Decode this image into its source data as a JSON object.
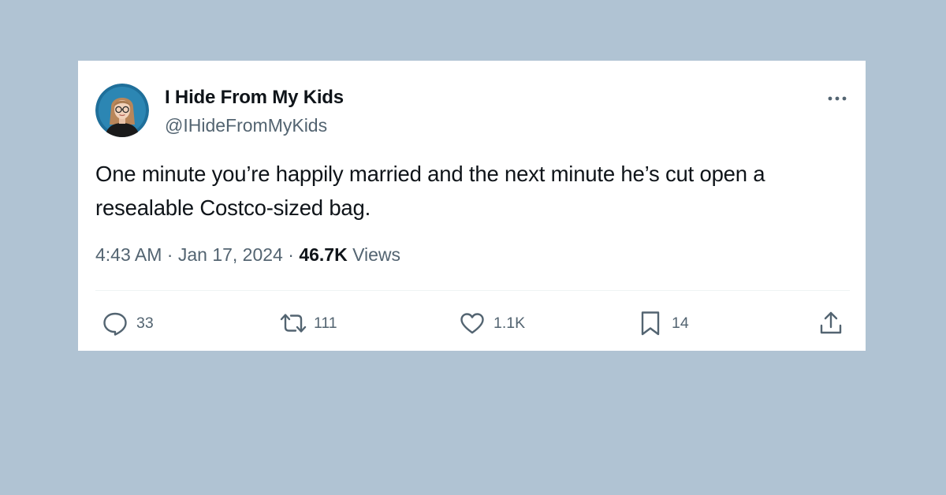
{
  "tweet": {
    "author": {
      "display_name": "I Hide From My Kids",
      "handle": "@IHideFromMyKids"
    },
    "text": "One minute you’re happily married and the next minute he’s cut open a resealable Costco-sized bag.",
    "meta": {
      "time": "4:43 AM",
      "separator1": " · ",
      "date": "Jan 17, 2024",
      "separator2": " · ",
      "views_count": "46.7K",
      "views_label": " Views"
    },
    "actions": {
      "replies": "33",
      "retweets": "111",
      "likes": "1.1K",
      "bookmarks": "14"
    }
  },
  "icons": {
    "more": "more-horizontal-icon",
    "reply": "reply-bubble-icon",
    "retweet": "retweet-icon",
    "like": "heart-icon",
    "bookmark": "bookmark-icon",
    "share": "share-upload-icon"
  },
  "colors": {
    "page_background": "#b0c3d3",
    "card_background": "#ffffff",
    "text_primary": "#0f1419",
    "text_secondary": "#536471",
    "avatar_ring": "#1f6f9a"
  }
}
